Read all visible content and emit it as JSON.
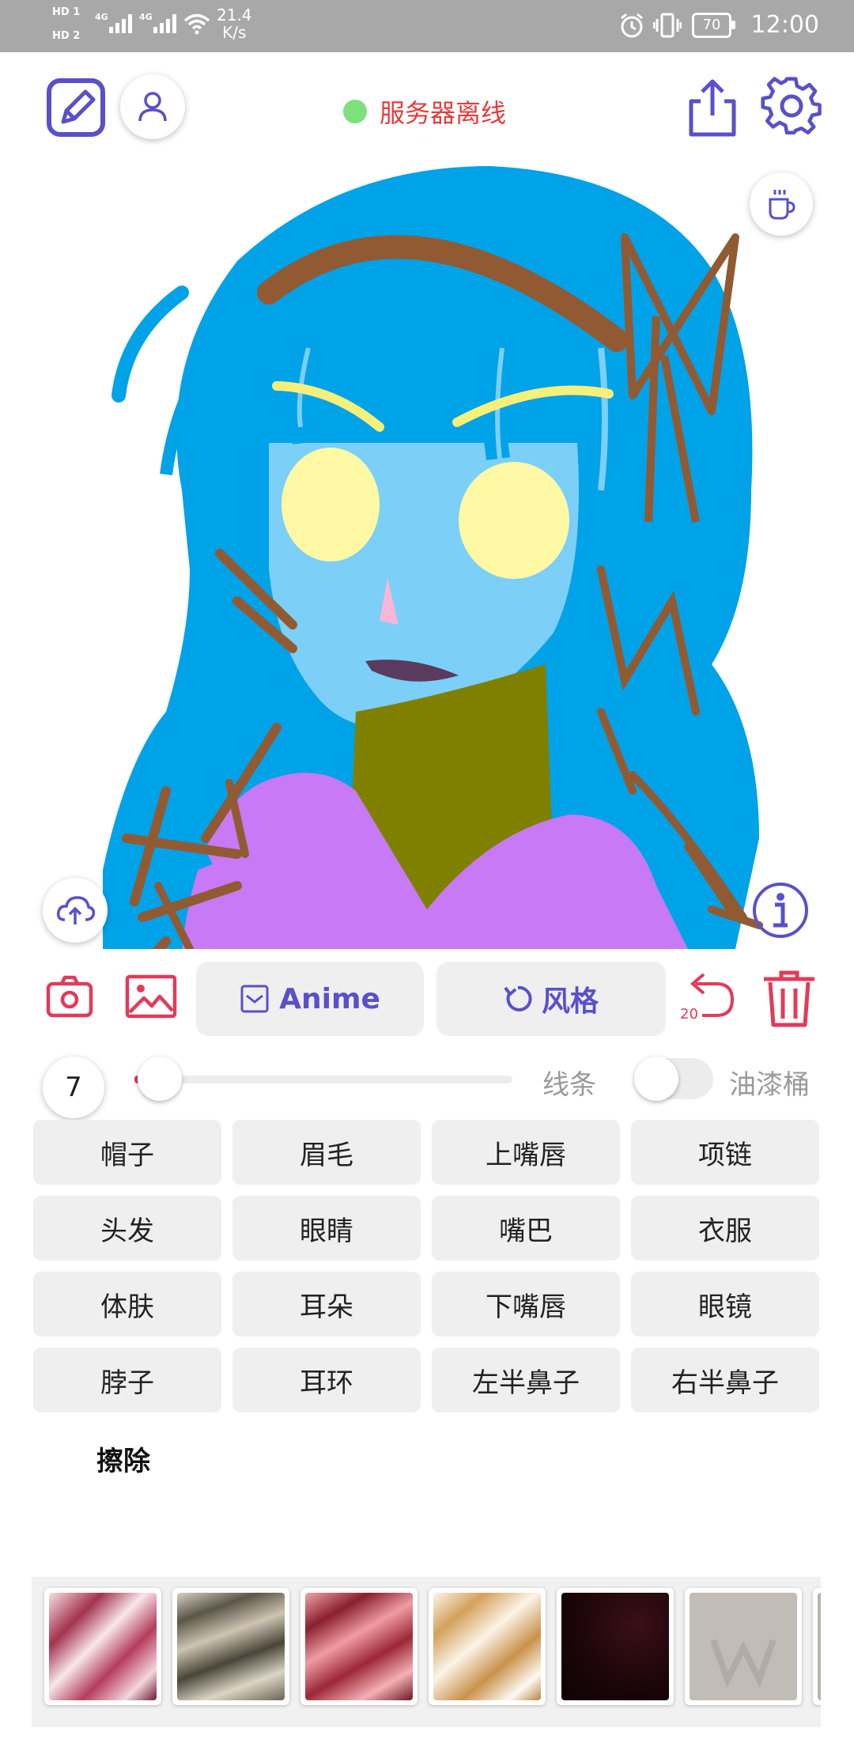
{
  "status_bar": {
    "sim1": "HD 1",
    "sim2": "HD 2",
    "net_type": "4G",
    "net_speed": "21.4",
    "net_unit": "K/s",
    "battery": "70",
    "time": "12:00"
  },
  "header": {
    "server_status": "服务器离线",
    "server_status_color": "#7de07a"
  },
  "toolbar": {
    "anime_label": "Anime",
    "style_label": "风格",
    "undo_count": "20"
  },
  "brush": {
    "size": "7",
    "size_slider_level": 0.03,
    "lines_label": "线条",
    "bucket_label": "油漆桶",
    "bucket_enabled": false
  },
  "parts": [
    "帽子",
    "眉毛",
    "上嘴唇",
    "项链",
    "头发",
    "眼睛",
    "嘴巴",
    "衣服",
    "体肤",
    "耳朵",
    "下嘴唇",
    "眼镜",
    "脖子",
    "耳环",
    "左半鼻子",
    "右半鼻子"
  ],
  "erase_label": "擦除",
  "colors": {
    "accent": "#5a50c8",
    "danger": "#e23b5a"
  },
  "swatches": [
    {
      "name": "red-white-marble"
    },
    {
      "name": "olive-gray-marble"
    },
    {
      "name": "pink-red-marble"
    },
    {
      "name": "cream-gold-marble"
    },
    {
      "name": "dark-maroon"
    },
    {
      "name": "gray-watermark"
    }
  ]
}
